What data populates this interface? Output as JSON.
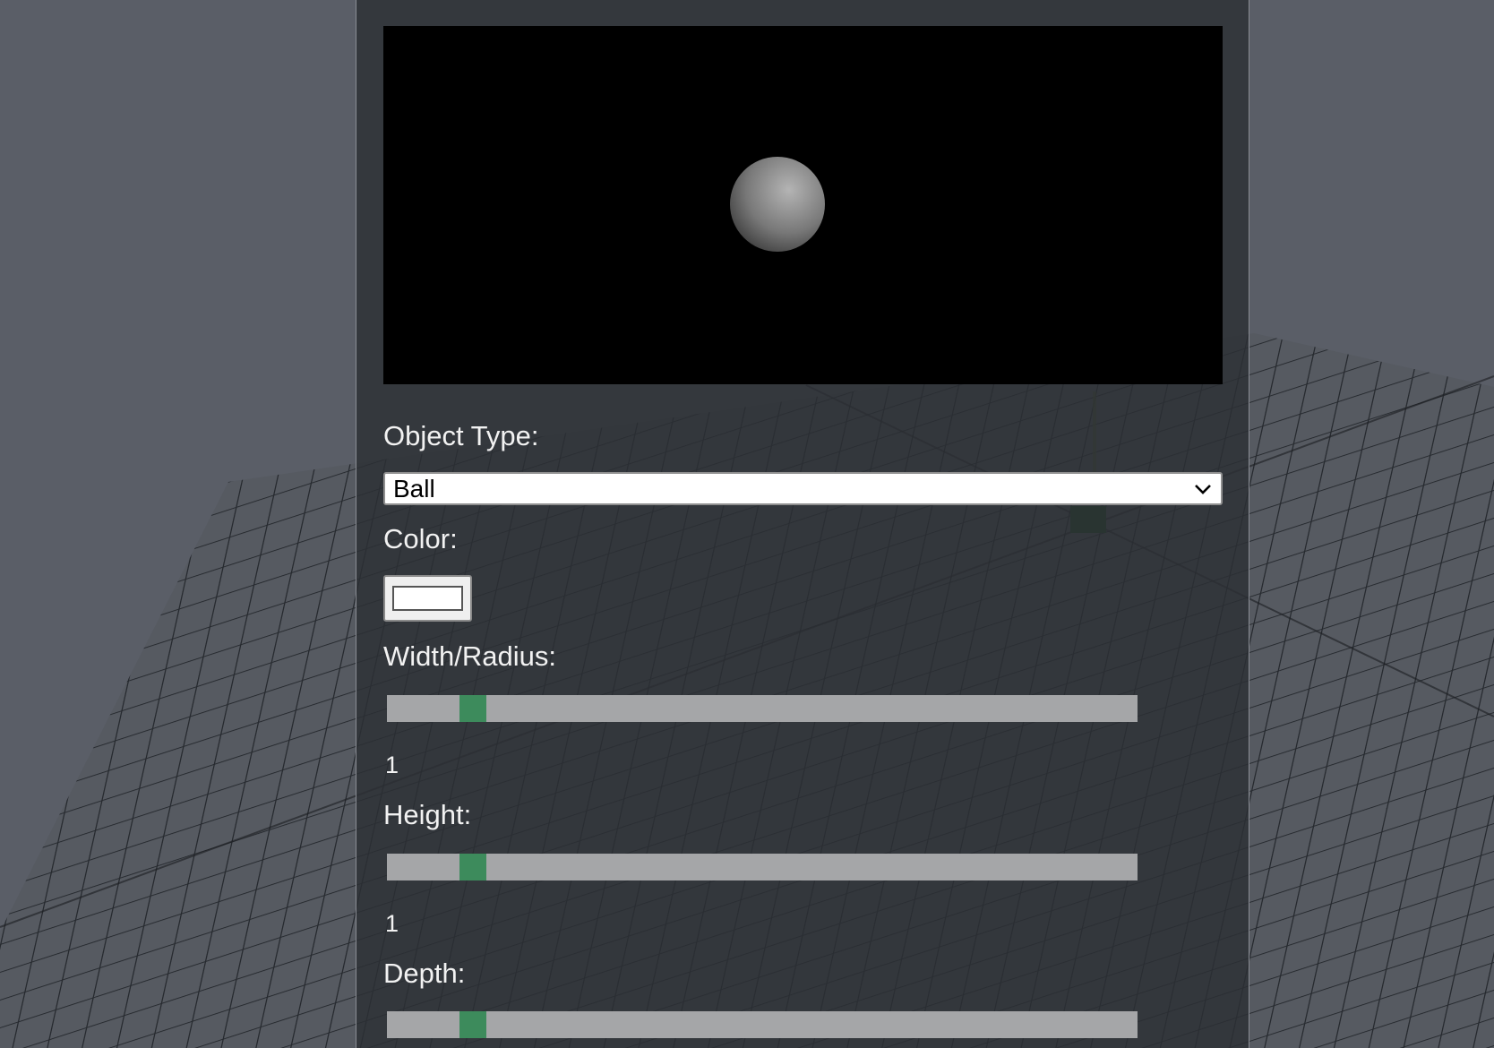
{
  "editor": {
    "object_type": {
      "label": "Object Type:",
      "selected": "Ball"
    },
    "color": {
      "label": "Color:",
      "value": "#ffffff"
    },
    "width_radius": {
      "label": "Width/Radius:",
      "value": "1",
      "level": 0.1
    },
    "height": {
      "label": "Height:",
      "value": "1",
      "level": 0.1
    },
    "depth": {
      "label": "Depth:",
      "level": 0.1
    }
  },
  "theme": {
    "slider_track": "#a5a6a8",
    "slider_thumb": "#3d8b5c",
    "panel_bg": "#2c2f35",
    "preview_bg": "#000000"
  }
}
